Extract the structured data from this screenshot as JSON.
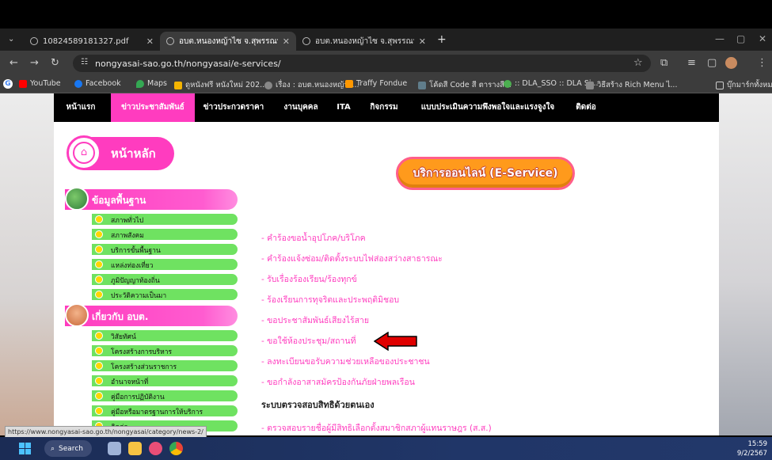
{
  "browser": {
    "tabs": [
      {
        "label": "10824589181327.pdf",
        "active": false
      },
      {
        "label": "อบต.หนองหญ้าไซ จ.สุพรรณบุรี",
        "active": true
      },
      {
        "label": "อบต.หนองหญ้าไซ จ.สุพรรณบุรี – อบ",
        "active": false
      }
    ],
    "new_tab": "+",
    "url": "nongyasai-sao.go.th/nongyasai/e-services/",
    "bookmarks": [
      {
        "label": "YouTube",
        "color": "#ff0000"
      },
      {
        "label": "Facebook",
        "color": "#1877f2"
      },
      {
        "label": "Maps",
        "color": "#34a853"
      },
      {
        "label": "ดูหนังฟรี หนังใหม่ 202...",
        "color": "#f4b400"
      },
      {
        "label": "เรื่อง : อบต.หนองหญ้าไ...",
        "color": "#888888"
      },
      {
        "label": "Traffy Fondue",
        "color": "#ff9800"
      },
      {
        "label": "โค้ดสี Code สี ตารางสี...",
        "color": "#607d8b"
      },
      {
        "label": ":: DLA_SSO :: DLA Si...",
        "color": "#4caf50"
      },
      {
        "label": "วิธีสร้าง Rich Menu ไ...",
        "color": "#888888"
      }
    ],
    "bookmarks_folder": "บุ๊กมาร์กทั้งหมด"
  },
  "site": {
    "nav": [
      {
        "label": "หน้าแรก",
        "active": false
      },
      {
        "label": "ข่าวประชาสัมพันธ์",
        "active": true
      },
      {
        "label": "ข่าวประกวดราคา",
        "active": false
      },
      {
        "label": "งานบุคคล",
        "active": false
      },
      {
        "label": "ITA",
        "active": false
      },
      {
        "label": "กิจกรรม",
        "active": false
      },
      {
        "label": "แบบประเมินความพึงพอใจและแรงจูงใจ",
        "active": false
      },
      {
        "label": "ติดต่อ",
        "active": false
      }
    ],
    "home_label": "หน้าหลัก",
    "sections": [
      {
        "title": "ข้อมูลพื้นฐาน",
        "items": [
          "สภาพทั่วไป",
          "สภาพสังคม",
          "บริการขั้นพื้นฐาน",
          "แหล่งท่องเที่ยว",
          "ภูมิปัญญาท้องถิ่น",
          "ประวัติความเป็นมา"
        ]
      },
      {
        "title": "เกี่ยวกับ อบต.",
        "items": [
          "วิสัยทัศน์",
          "โครงสร้างการบริหาร",
          "โครงสร้างส่วนราชการ",
          "อำนาจหน้าที่",
          "คู่มือการปฏิบัติงาน",
          "คู่มือหรือมาตรฐานการให้บริการ",
          "ติดต่อ"
        ]
      }
    ],
    "eservice_title": "บริการออนไลน์ (E-Service)",
    "services": [
      "- คำร้องขอน้ำอุปโภค/บริโภค",
      "- คำร้องแจ้งซ่อม/ติดตั้งระบบไฟส่องสว่างสาธารณะ",
      "- รับเรื่องร้องเรียน/ร้องทุกข์",
      "- ร้องเรียนการทุจริตและประพฤติมิชอบ",
      "- ขอประชาสัมพันธ์เสียงไร้สาย",
      "- ขอใช้ห้องประชุม/สถานที่",
      "- ลงทะเบียนขอรับความช่วยเหลือของประชาชน",
      "- ขอกำลังอาสาสมัครป้องกันภัยฝ่ายพลเรือน"
    ],
    "audit_title": "ระบบตรวจสอบสิทธิด้วยตนเอง",
    "audit_link": "- ตรวจสอบรายชื่อผู้มีสิทธิเลือกตั้งสมาชิกสภาผู้แทนราษฎร (ส.ส.)"
  },
  "status_url": "https://www.nongyasai-sao.go.th/nongyasai/category/news-2/",
  "taskbar": {
    "search_label": "Search",
    "time": "15:59",
    "date": "9/2/2567"
  },
  "colors": {
    "accent_pink": "#ff3cbf",
    "menu_green": "#6fe261",
    "eservice_orange": "#ff9a1c",
    "arrow_red": "#e00000"
  }
}
